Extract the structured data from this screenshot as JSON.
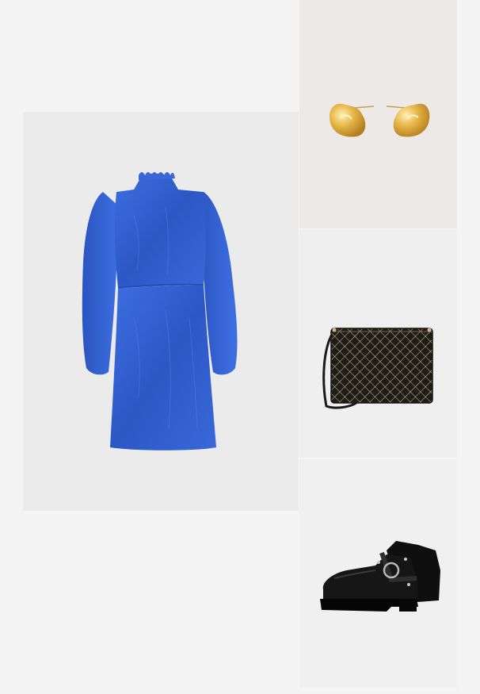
{
  "collage": {
    "background_color": "#f4f4f4",
    "items": [
      {
        "name": "dress",
        "color": "#2f5fcf",
        "tile_color": "#ebebeb"
      },
      {
        "name": "earrings",
        "color": "#e2b24a",
        "tile_color": "#ece9e7"
      },
      {
        "name": "clutch-bag",
        "color": "#222018",
        "tile_color": "#efefef"
      },
      {
        "name": "ankle-boots",
        "color": "#151515",
        "tile_color": "#f0f0f0"
      }
    ]
  }
}
